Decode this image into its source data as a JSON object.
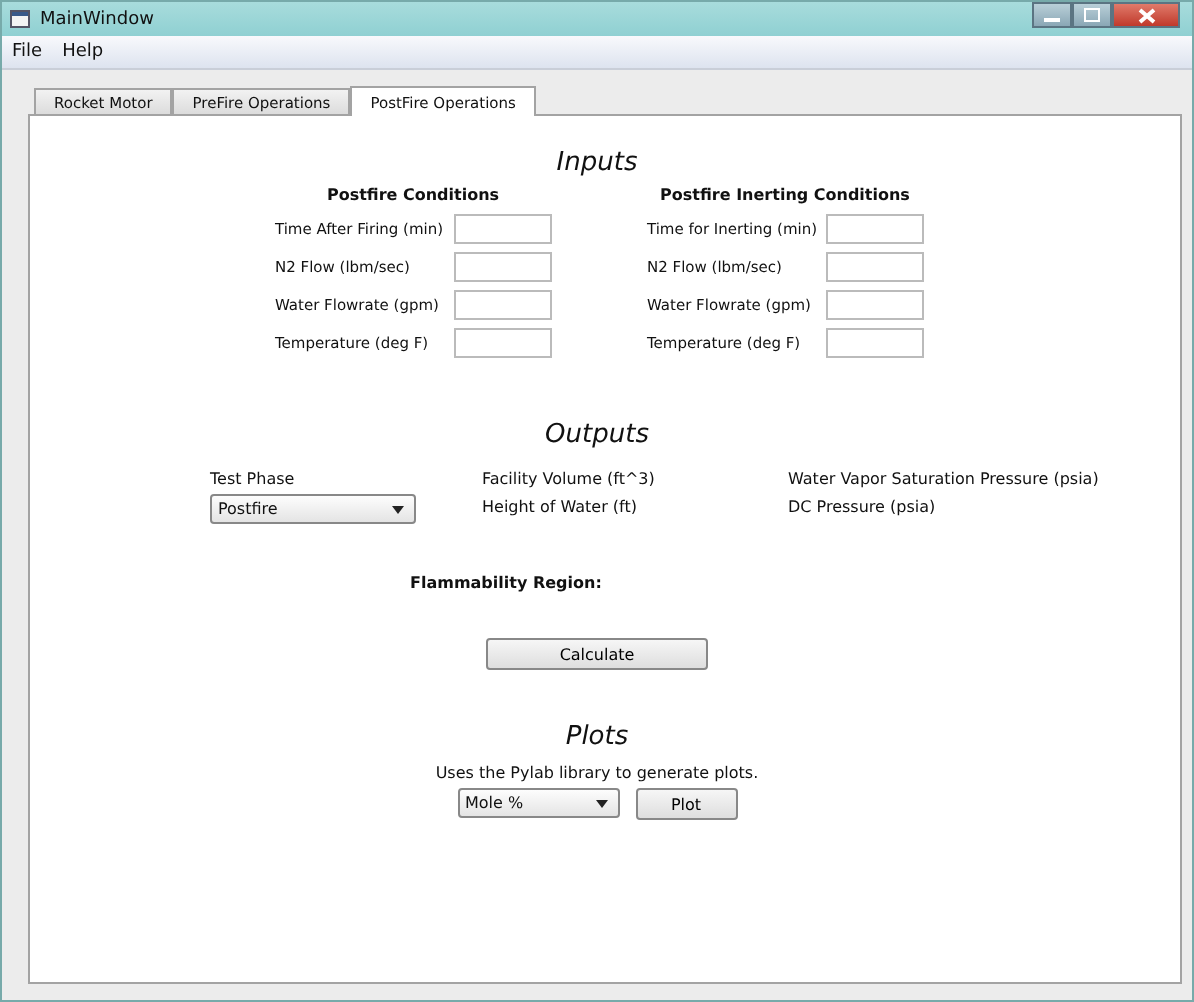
{
  "window": {
    "title": "MainWindow"
  },
  "menu": [
    "File",
    "Help"
  ],
  "tabs": [
    {
      "label": "Rocket Motor",
      "selected": false
    },
    {
      "label": "PreFire Operations",
      "selected": false
    },
    {
      "label": "PostFire Operations",
      "selected": true
    }
  ],
  "inputs": {
    "title": "Inputs",
    "groups": [
      {
        "heading": "Postfire Conditions",
        "fields": [
          "Time After Firing (min)",
          "N2 Flow (lbm/sec)",
          "Water Flowrate (gpm)",
          "Temperature (deg F)"
        ]
      },
      {
        "heading": "Postfire Inerting Conditions",
        "fields": [
          "Time for Inerting (min)",
          "N2 Flow (lbm/sec)",
          "Water Flowrate (gpm)",
          "Temperature (deg F)"
        ]
      }
    ]
  },
  "outputs": {
    "title": "Outputs",
    "test_phase": {
      "label": "Test Phase",
      "value": "Postfire"
    },
    "columns": [
      [
        "Facility Volume (ft^3)",
        "Height of Water (ft)"
      ],
      [
        "Water Vapor Saturation Pressure (psia)",
        "DC Pressure (psia)"
      ]
    ],
    "flammability": "Flammability Region:",
    "button": "Calculate"
  },
  "plots": {
    "title": "Plots",
    "description": "Uses the Pylab library to generate plots.",
    "value": "Mole %",
    "button": "Plot"
  }
}
